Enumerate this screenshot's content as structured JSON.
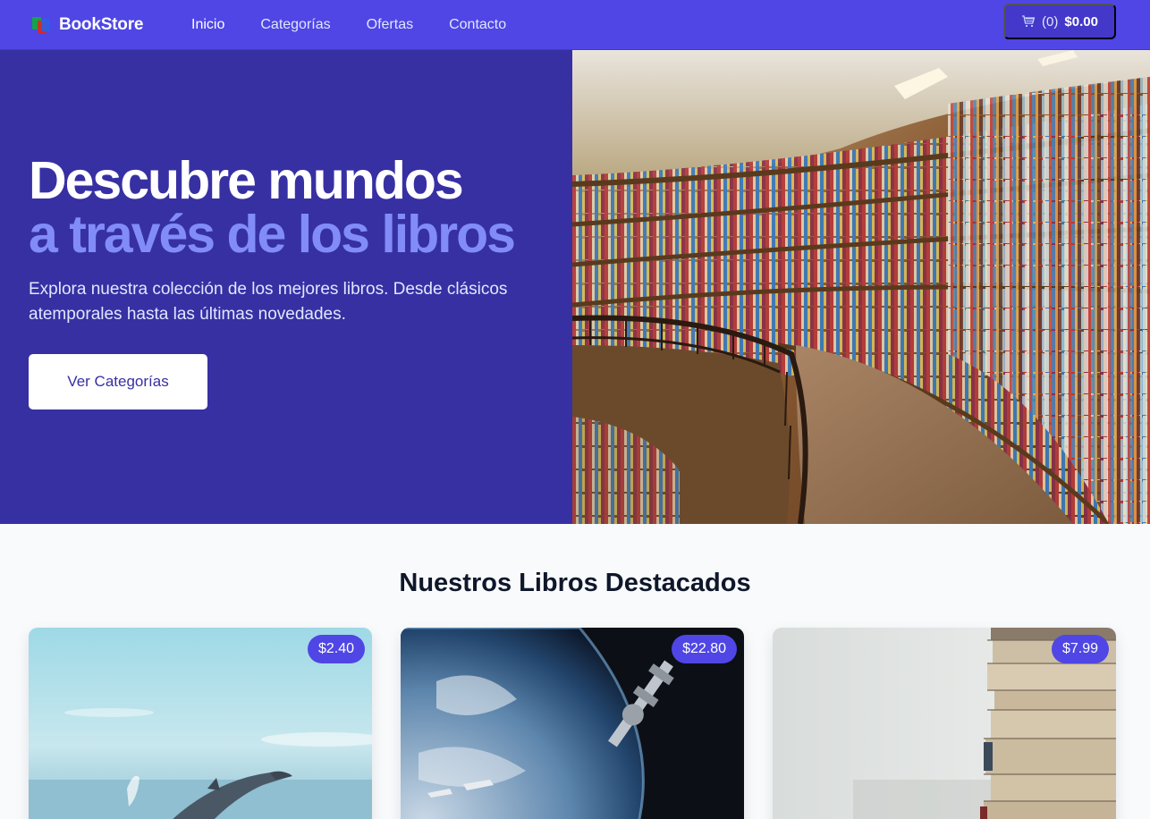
{
  "brand": {
    "name": "BookStore"
  },
  "nav": {
    "links": [
      {
        "label": "Inicio",
        "active": true
      },
      {
        "label": "Categorías",
        "active": false
      },
      {
        "label": "Ofertas",
        "active": false
      },
      {
        "label": "Contacto",
        "active": false
      }
    ]
  },
  "cart": {
    "icon": "cart-icon",
    "count": "(0)",
    "total": "$0.00"
  },
  "hero": {
    "title_line1": "Descubre mundos",
    "title_line2": "a través de los libros",
    "subtitle": "Explora nuestra colección de los mejores libros. Desde clásicos atemporales hasta las últimas novedades.",
    "cta_label": "Ver Categorías",
    "image": "library-bookshelves-photo"
  },
  "featured": {
    "title": "Nuestros Libros Destacados",
    "books": [
      {
        "price": "$2.40",
        "image": "dolphin-jumping-photo"
      },
      {
        "price": "$22.80",
        "image": "earth-space-station-photo"
      },
      {
        "price": "$7.99",
        "image": "stacked-books-photo"
      }
    ]
  },
  "colors": {
    "nav_bg": "#4f46e5",
    "hero_bg": "#3730a3",
    "accent": "#818cf8",
    "price_badge": "#4f46e5",
    "page_bg": "#f8fafc"
  }
}
